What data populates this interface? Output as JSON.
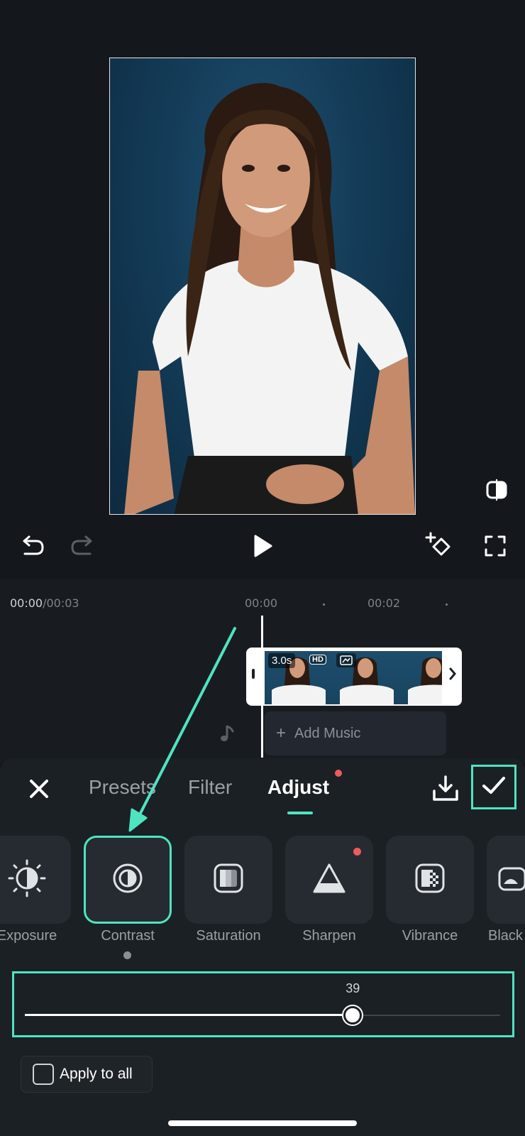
{
  "timeline": {
    "current_time": "00:00",
    "total_time": "/00:03",
    "ruler_marks": [
      "00:00",
      "00:02"
    ],
    "clip_duration": "3.0s",
    "clip_hd_badge": "HD",
    "add_music": "Add Music"
  },
  "panel": {
    "tabs": [
      {
        "label": "Presets",
        "active": false
      },
      {
        "label": "Filter",
        "active": false
      },
      {
        "label": "Adjust",
        "active": true
      }
    ],
    "tools": [
      {
        "label": "Exposure",
        "icon": "exposure-icon"
      },
      {
        "label": "Contrast",
        "icon": "contrast-icon",
        "selected": true
      },
      {
        "label": "Saturation",
        "icon": "saturation-icon"
      },
      {
        "label": "Sharpen",
        "icon": "sharpen-icon",
        "has_dot": true
      },
      {
        "label": "Vibrance",
        "icon": "vibrance-icon"
      },
      {
        "label": "Black",
        "icon": "black-icon"
      }
    ],
    "slider": {
      "value": "39",
      "fraction": 0.69
    },
    "apply_all_label": "Apply to all"
  },
  "colors": {
    "accent": "#4fe3c1",
    "background": "#14181c",
    "panel": "#1b2025",
    "notification_dot": "#f05a5a"
  }
}
